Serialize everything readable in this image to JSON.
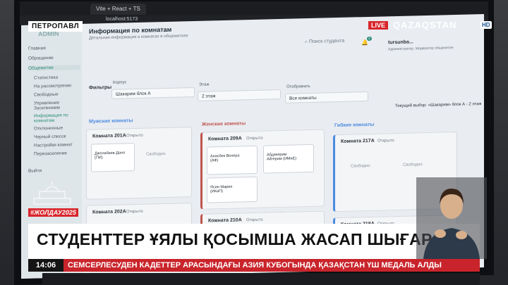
{
  "tv": {
    "city": "ПЕТРОПАВЛ",
    "live": "LIVE",
    "channel": "QAZAQSTAN",
    "hd": "HD",
    "campaign": "#ЖОЛДАУ2025",
    "headline": "СТУДЕНТТЕР ҰЯЛЫ ҚОСЫМША ЖАСАП ШЫҒАРДЫ",
    "time": "14:06",
    "ticker": "СЕМСЕРЛЕСУДЕН КАДЕТТЕР АРАСЫНДАҒЫ АЗИЯ КУБОГЫНДА ҚАЗАҚСТАН ҮШ МЕДАЛЬ АЛДЫ"
  },
  "browser": {
    "tab": "Vite + React + TS",
    "url": "localhost:5173"
  },
  "app": {
    "brand": "ADMIN",
    "page_title": "Информация по комнатам",
    "page_subtitle": "Детальная информация о комнатах в общежитиях",
    "search_placeholder": "Поиск студента",
    "notifications": "2",
    "user_name": "tursunba...",
    "user_role": "Администратор, Модератор общежития",
    "sidebar": [
      "Главная",
      "Обращение",
      "Общежитие",
      "Статистика",
      "На рассмотрении",
      "Свободные",
      "Управление Заселением",
      "Информация по комнатам",
      "Отклоненные",
      "Черный список",
      "Настройки комнат",
      "Перезаселение",
      "Выйти"
    ],
    "filters_label": "Фильтры",
    "filter_building_label": "Корпус",
    "filter_building_value": "Шакарим блок А",
    "filter_floor_label": "Этаж",
    "filter_floor_value": "2 этаж",
    "filter_display_label": "Отображать",
    "filter_display_value": "Все комнаты",
    "current_choice": "Текущий выбор: «Шакарим» блок А - 2 этаж",
    "col_male": "Мужские комнаты",
    "col_female": "Женские комнаты",
    "col_flex": "Гибкие комнаты",
    "rooms": {
      "r201": "Комната 201А",
      "r202": "Комната 202А",
      "r209": "Комната 209А",
      "r210": "Комната 210А",
      "r217": "Комната 217А",
      "r218": "Комната 218А",
      "status_open": "Открыто",
      "free": "Свободно"
    },
    "beds": {
      "b1": "Джолабаев Даня (ПИ)",
      "b2": "Анасбек Венера (АФ)",
      "b3": "Абдикерим Айгерим (ИМиЕ)",
      "b4": "Ясин Мария (ИКиП)"
    }
  }
}
